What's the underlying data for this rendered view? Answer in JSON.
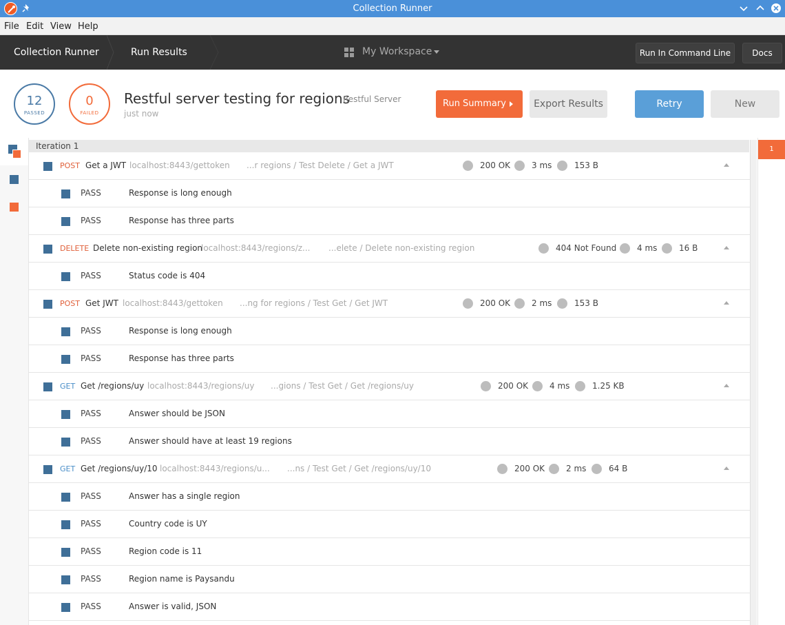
{
  "window": {
    "title": "Collection Runner"
  },
  "menu": [
    "File",
    "Edit",
    "View",
    "Help"
  ],
  "header": {
    "crumbs": [
      "Collection Runner",
      "Run Results"
    ],
    "workspace": "My Workspace",
    "cmd_label": "Run In Command Line",
    "docs_label": "Docs"
  },
  "summary": {
    "passed_count": "12",
    "passed_label": "PASSED",
    "failed_count": "0",
    "failed_label": "FAILED",
    "run_title": "Restful server testing for regions",
    "environment": "Restful Server",
    "time": "just now",
    "run_summary_label": "Run Summary",
    "export_label": "Export Results",
    "retry_label": "Retry",
    "new_label": "New"
  },
  "iteration": {
    "label": "Iteration 1",
    "tab": "1"
  },
  "requests": [
    {
      "method": "POST",
      "name": "Get a JWT",
      "url": "localhost:8443/gettoken",
      "path": "...r regions / Test Delete / Get a JWT",
      "status": "200 OK",
      "time": "3 ms",
      "size": "153 B",
      "tests": [
        {
          "result": "PASS",
          "name": "Response is long enough"
        },
        {
          "result": "PASS",
          "name": "Response has three parts"
        }
      ]
    },
    {
      "method": "DELETE",
      "name": "Delete non-existing region",
      "url": "localhost:8443/regions/z...",
      "path": "...elete / Delete non-existing region",
      "status": "404 Not Found",
      "time": "4 ms",
      "size": "16 B",
      "tests": [
        {
          "result": "PASS",
          "name": "Status code is 404"
        }
      ]
    },
    {
      "method": "POST",
      "name": "Get JWT",
      "url": "localhost:8443/gettoken",
      "path": "...ng for regions / Test Get / Get JWT",
      "status": "200 OK",
      "time": "2 ms",
      "size": "153 B",
      "tests": [
        {
          "result": "PASS",
          "name": "Response is long enough"
        },
        {
          "result": "PASS",
          "name": "Response has three parts"
        }
      ]
    },
    {
      "method": "GET",
      "name": "Get /regions/uy",
      "url": "localhost:8443/regions/uy",
      "path": "...gions / Test Get / Get /regions/uy",
      "status": "200 OK",
      "time": "4 ms",
      "size": "1.25 KB",
      "tests": [
        {
          "result": "PASS",
          "name": "Answer should be JSON"
        },
        {
          "result": "PASS",
          "name": "Answer should have at least 19 regions"
        }
      ]
    },
    {
      "method": "GET",
      "name": "Get /regions/uy/10",
      "url": "localhost:8443/regions/u...",
      "path": "...ns / Test Get / Get /regions/uy/10",
      "status": "200 OK",
      "time": "2 ms",
      "size": "64 B",
      "tests": [
        {
          "result": "PASS",
          "name": "Answer has a single region"
        },
        {
          "result": "PASS",
          "name": "Country code is UY"
        },
        {
          "result": "PASS",
          "name": "Region code is 11"
        },
        {
          "result": "PASS",
          "name": "Region name is Paysandu"
        },
        {
          "result": "PASS",
          "name": "Answer is valid, JSON"
        }
      ]
    }
  ],
  "colors": {
    "titlebar": "#4a90d9",
    "header": "#333333",
    "accent_orange": "#f26b3a",
    "retry_blue": "#5a9fd8",
    "pass_blue": "#3f6f98"
  }
}
